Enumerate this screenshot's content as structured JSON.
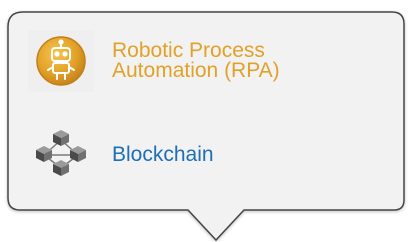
{
  "menu": {
    "items": [
      {
        "label": "Robotic Process Automation (RPA)",
        "icon": "robot-icon",
        "color": "#E2A128"
      },
      {
        "label": "Blockchain",
        "icon": "blockchain-icon",
        "color": "#1F6FB6"
      }
    ]
  },
  "colors": {
    "popover_background": "#f2f2f2",
    "popover_border": "#444444"
  }
}
